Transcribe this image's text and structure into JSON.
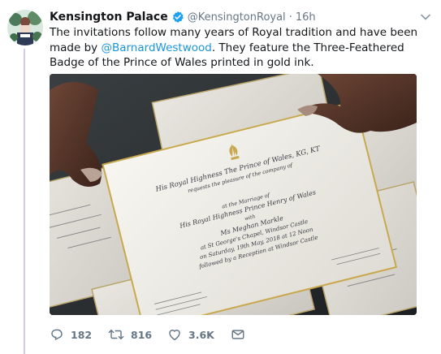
{
  "tweet": {
    "author_name": "Kensington Palace",
    "author_handle": "@KensingtonRoyal",
    "separator": "·",
    "time": "16h",
    "text_before_mention": "The invitations follow many years of Royal tradition and have been made by ",
    "mention": "@BarnardWestwood",
    "text_after_mention": ". They feature the Three-Feathered Badge of the Prince of Wales printed in gold ink.",
    "media_icon": "photo-of-wedding-invitations",
    "verified_icon": "verified-badge-icon",
    "colors": {
      "text": "#14171a",
      "muted": "#657786",
      "link": "#1b95e0",
      "thread_line": "#d6cbe7",
      "verified": "#1da1f2"
    }
  },
  "actions": {
    "reply": {
      "icon": "reply-icon",
      "count": "182"
    },
    "retweet": {
      "icon": "retweet-icon",
      "count": "816"
    },
    "like": {
      "icon": "heart-icon",
      "count": "3.6K"
    },
    "message": {
      "icon": "envelope-icon"
    }
  },
  "invitation": {
    "line1": "His Royal Highness The Prince of Wales, KG, KT",
    "line2": "requests the pleasure of the company of",
    "line3": "at the Marriage of",
    "line4": "His Royal Highness Prince Henry of Wales",
    "line5": "with",
    "line6": "Ms Meghan Markle",
    "line7": "at St George's Chapel, Windsor Castle",
    "line8": "on Saturday, 19th May, 2018 at 12 Noon",
    "line9": "followed by a Reception at Windsor Castle"
  }
}
